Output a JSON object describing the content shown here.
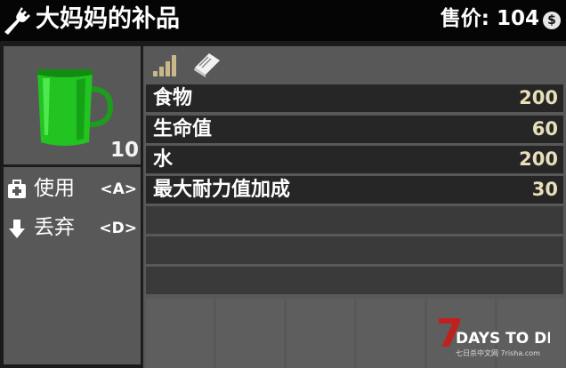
{
  "header": {
    "title": "大妈妈的补品",
    "price_label": "售价: 104",
    "currency_icon_text": "$"
  },
  "item": {
    "quantity": "10",
    "icon": "green-mug-icon"
  },
  "actions": [
    {
      "label": "使用",
      "key": "<A>",
      "icon": "first-aid-icon"
    },
    {
      "label": "丢弃",
      "key": "<D>",
      "icon": "arrow-down-icon"
    }
  ],
  "stat_icons": [
    "quality-bars-icon",
    "recipe-book-icon"
  ],
  "stats": [
    {
      "label": "食物",
      "value": "200"
    },
    {
      "label": "生命值",
      "value": "60"
    },
    {
      "label": "水",
      "value": "200"
    },
    {
      "label": "最大耐力值加成",
      "value": "30"
    }
  ],
  "quality_level": 4,
  "logo": {
    "numeral": "7",
    "text": "DAYS TO DIE",
    "sub": "七日杀中文网 7risha.com"
  },
  "colors": {
    "header_bg": "#050505",
    "panel_bg": "#585858",
    "row_bg": "#262626",
    "value_color": "#e8dfb8",
    "quality_color": "#c8b88a",
    "logo_red": "#c0201e"
  }
}
